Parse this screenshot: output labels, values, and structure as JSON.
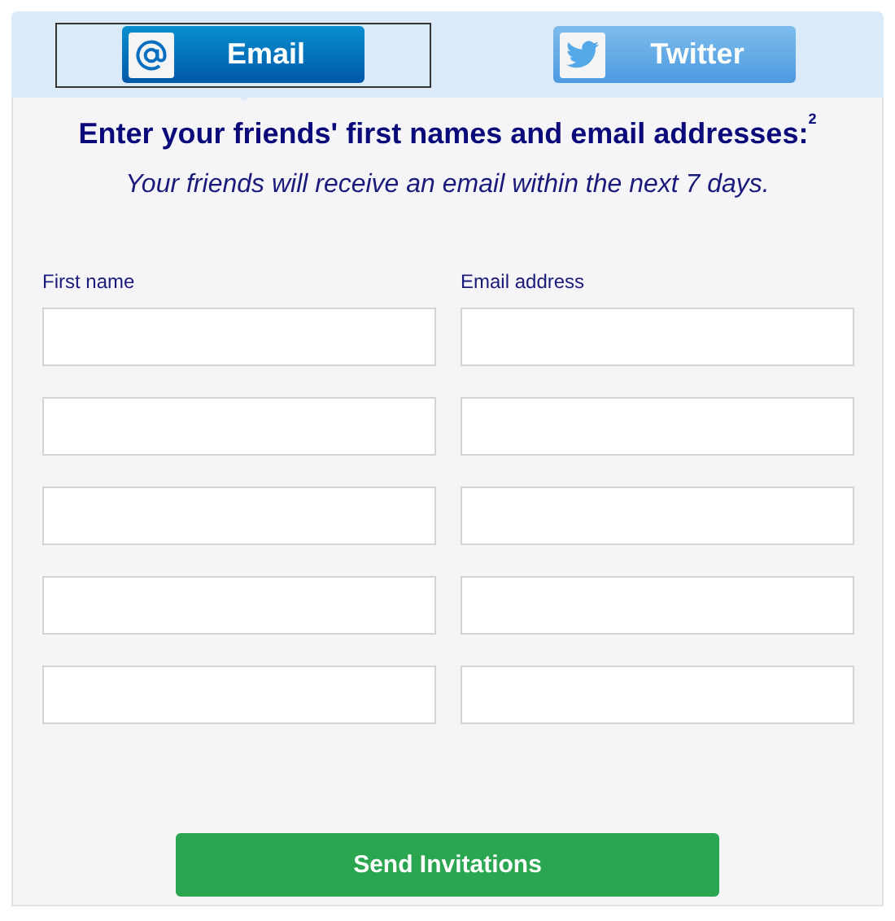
{
  "tabs": [
    {
      "kind": "email",
      "label": "Email",
      "selected": true
    },
    {
      "kind": "twitter",
      "label": "Twitter",
      "selected": false
    }
  ],
  "heading": "Enter your friends' first names and email addresses:$^{2}$",
  "subheading": "Your friends will receive an email within the next 7 days.",
  "columns": [
    "First name",
    "Email address"
  ],
  "submit": "Send Invitations"
}
